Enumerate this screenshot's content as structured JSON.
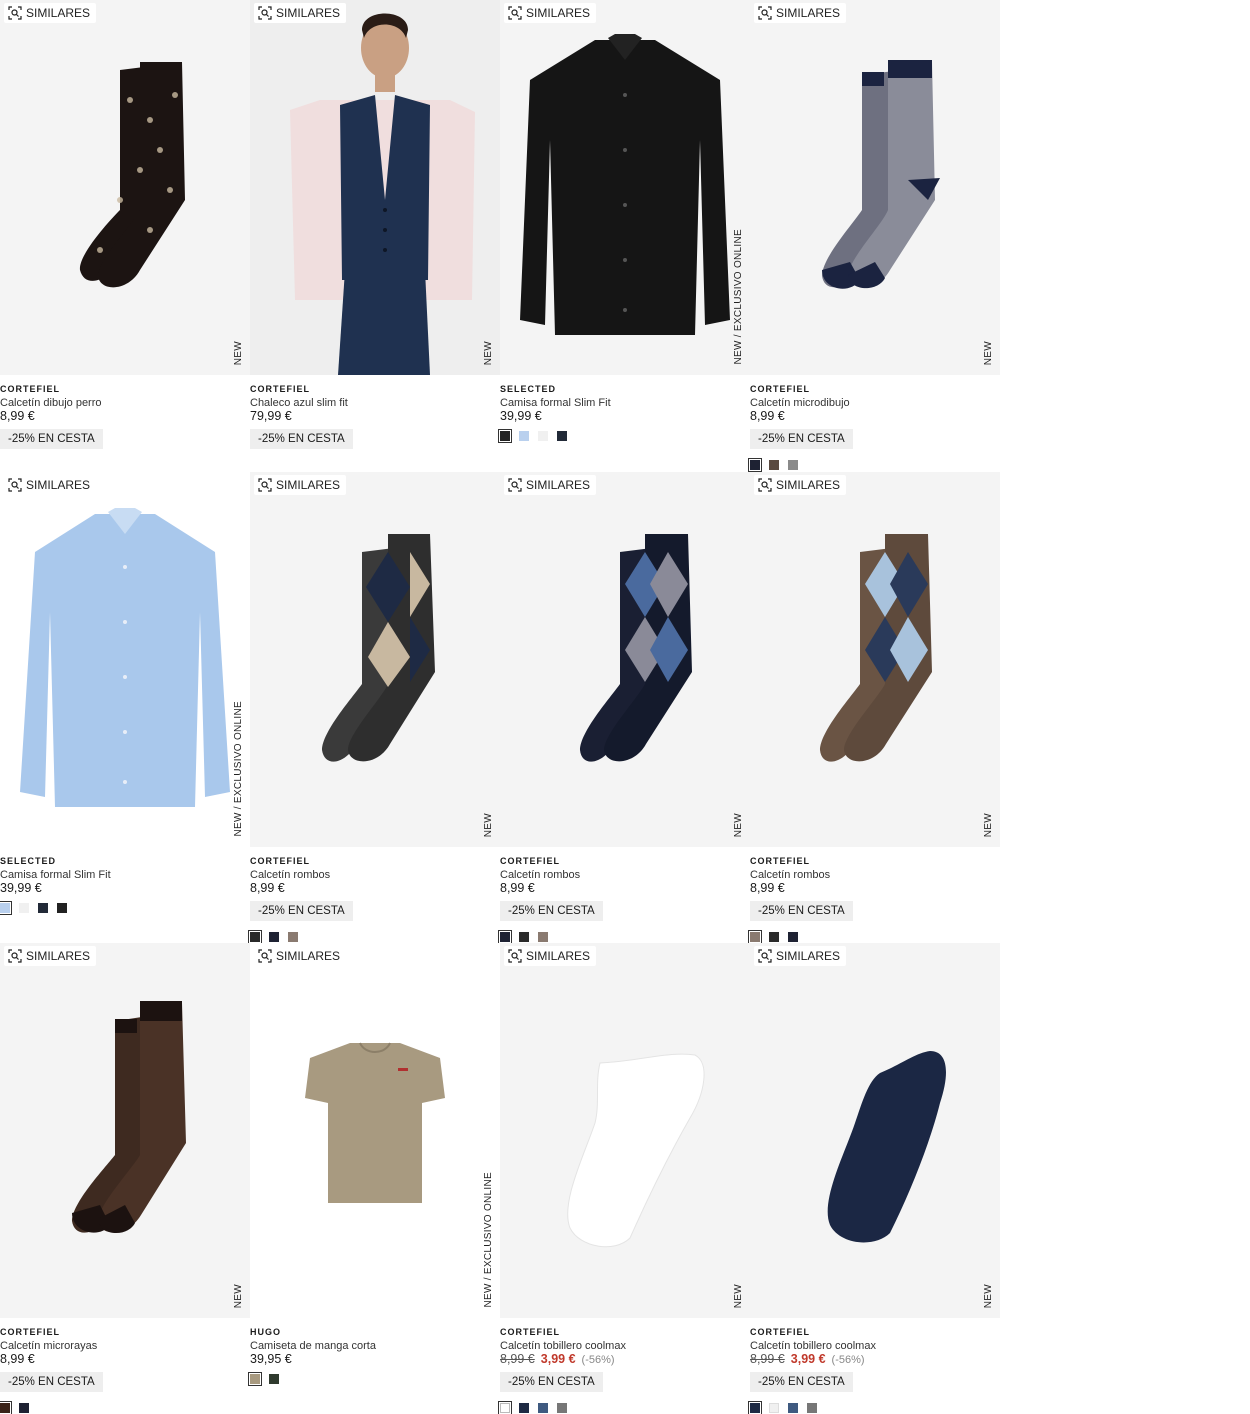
{
  "similar_label": "SIMILARES",
  "products": [
    {
      "brand": "CORTEFIEL",
      "name": "Calcetín dibujo perro",
      "price": "8,99 €",
      "promo": "-25% EN CESTA",
      "tags": "NEW",
      "swatches": []
    },
    {
      "brand": "CORTEFIEL",
      "name": "Chaleco azul slim fit",
      "price": "79,99 €",
      "promo": "-25% EN CESTA",
      "tags": "NEW",
      "swatches": []
    },
    {
      "brand": "SELECTED",
      "name": "Camisa formal Slim Fit",
      "price": "39,99 €",
      "promo": "",
      "tags": "NEW / EXCLUSIVO ONLINE",
      "swatches": [
        "#222222",
        "#b9d0ee",
        "#f0f0f0",
        "#222a38"
      ]
    },
    {
      "brand": "CORTEFIEL",
      "name": "Calcetín microdibujo",
      "price": "8,99 €",
      "promo": "-25% EN CESTA",
      "tags": "NEW",
      "swatches": [
        "#1e2233",
        "#5a4a40",
        "#8a8a8a"
      ]
    },
    {
      "brand": "SELECTED",
      "name": "Camisa formal Slim Fit",
      "price": "39,99 €",
      "promo": "",
      "tags": "NEW / EXCLUSIVO ONLINE",
      "swatches": [
        "#b9d0ee",
        "#f0f0f0",
        "#222a38",
        "#222222"
      ]
    },
    {
      "brand": "CORTEFIEL",
      "name": "Calcetín rombos",
      "price": "8,99 €",
      "promo": "-25% EN CESTA",
      "tags": "NEW",
      "swatches": [
        "#2a2a2a",
        "#1e2233",
        "#8a7a70"
      ]
    },
    {
      "brand": "CORTEFIEL",
      "name": "Calcetín rombos",
      "price": "8,99 €",
      "promo": "-25% EN CESTA",
      "tags": "NEW",
      "swatches": [
        "#1e2233",
        "#2a2a2a",
        "#8a7a70"
      ]
    },
    {
      "brand": "CORTEFIEL",
      "name": "Calcetín rombos",
      "price": "8,99 €",
      "promo": "-25% EN CESTA",
      "tags": "NEW",
      "swatches": [
        "#8a7a70",
        "#2a2a2a",
        "#1e2233"
      ]
    },
    {
      "brand": "CORTEFIEL",
      "name": "Calcetín microrayas",
      "price": "8,99 €",
      "promo": "-25% EN CESTA",
      "tags": "NEW",
      "swatches": [
        "#3a2218",
        "#1e2233"
      ]
    },
    {
      "brand": "HUGO",
      "name": "Camiseta de manga corta",
      "price": "39,95 €",
      "promo": "",
      "tags": "NEW / EXCLUSIVO ONLINE",
      "swatches": [
        "#a89a80",
        "#2f3a2e"
      ]
    },
    {
      "brand": "CORTEFIEL",
      "name": "Calcetín tobillero coolmax",
      "price": "",
      "old_price": "8,99 €",
      "sale_price": "3,99 €",
      "discount": "(-56%)",
      "promo": "-25% EN CESTA",
      "tags": "NEW",
      "swatches": [
        "#ffffff",
        "#1e2a44",
        "#3f5a80",
        "#777777"
      ]
    },
    {
      "brand": "CORTEFIEL",
      "name": "Calcetín tobillero coolmax",
      "price": "",
      "old_price": "8,99 €",
      "sale_price": "3,99 €",
      "discount": "(-56%)",
      "promo": "-25% EN CESTA",
      "tags": "NEW",
      "swatches": [
        "#1e2a44",
        "#f0f0f0",
        "#3f5a80",
        "#777777"
      ]
    }
  ],
  "colors": {
    "accent_sale": "#c0392b",
    "promo_bg": "#eeeeee",
    "image_bg": "#f4f4f4"
  }
}
